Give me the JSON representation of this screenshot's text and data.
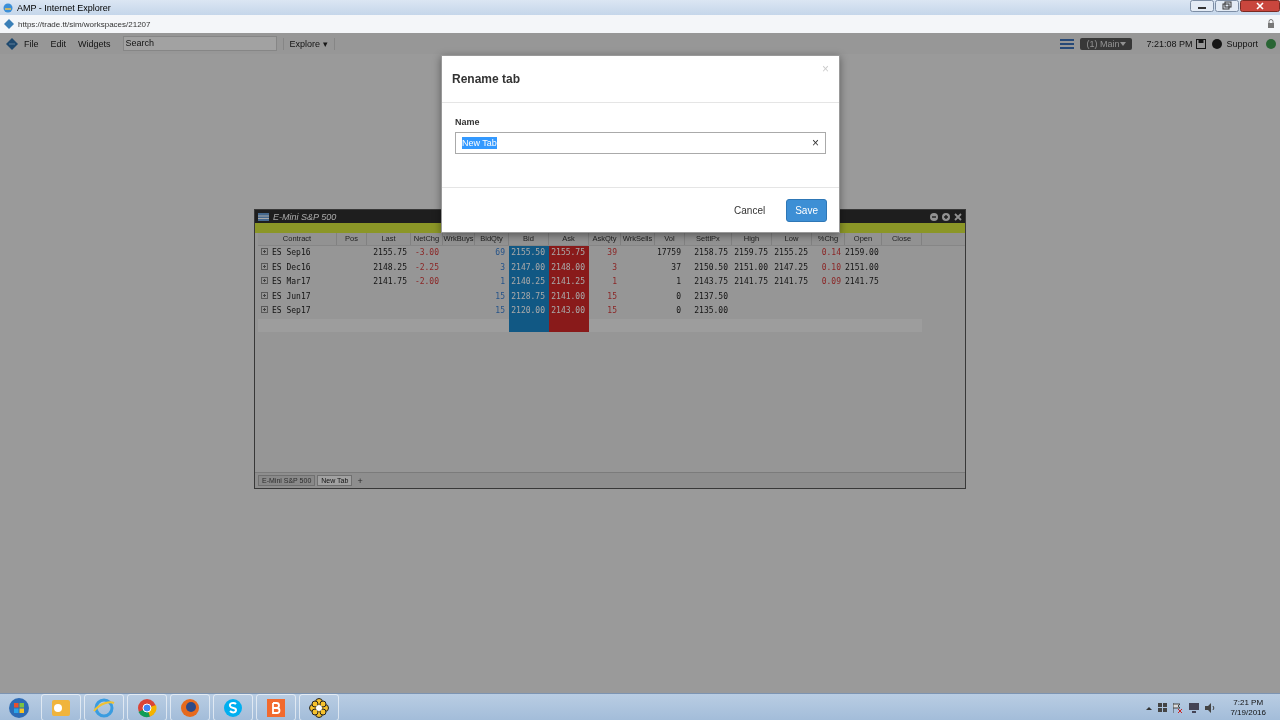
{
  "browser": {
    "title": "AMP - Internet Explorer",
    "address": "https://trade.tt/sim/workspaces/21207"
  },
  "toolbar": {
    "menus": [
      "File",
      "Edit",
      "Widgets"
    ],
    "search": {
      "placeholder": "Search"
    },
    "explore": "Explore ▾",
    "workspace": "(1) Main",
    "time": "7:21:08 PM",
    "support": "Support"
  },
  "widget": {
    "title": "E-Mini S&P 500",
    "columns": [
      "Contract",
      "Pos",
      "Last",
      "NetChg",
      "WrkBuys",
      "BidQty",
      "Bid",
      "Ask",
      "AskQty",
      "WrkSells",
      "Vol",
      "SettlPx",
      "High",
      "Low",
      "%Chg",
      "Open",
      "Close"
    ],
    "rows": [
      [
        "ES Sep16",
        "",
        "2155.75",
        "-3.00",
        "",
        "69",
        "2155.50",
        "2155.75",
        "39",
        "",
        "17759",
        "2158.75",
        "2159.75",
        "2155.25",
        "0.14",
        "2159.00",
        ""
      ],
      [
        "ES Dec16",
        "",
        "2148.25",
        "-2.25",
        "",
        "3",
        "2147.00",
        "2148.00",
        "3",
        "",
        "37",
        "2150.50",
        "2151.00",
        "2147.25",
        "0.10",
        "2151.00",
        ""
      ],
      [
        "ES Mar17",
        "",
        "2141.75",
        "-2.00",
        "",
        "1",
        "2140.25",
        "2141.25",
        "1",
        "",
        "1",
        "2143.75",
        "2141.75",
        "2141.75",
        "0.09",
        "2141.75",
        ""
      ],
      [
        "ES Jun17",
        "",
        "",
        "",
        "",
        "15",
        "2128.75",
        "2141.00",
        "15",
        "",
        "0",
        "2137.50",
        "",
        "",
        "",
        "",
        ""
      ],
      [
        "ES Sep17",
        "",
        "",
        "",
        "",
        "15",
        "2120.00",
        "2143.00",
        "15",
        "",
        "0",
        "2135.00",
        "",
        "",
        "",
        "",
        ""
      ]
    ],
    "tabs": [
      {
        "label": "E-Mini S&P 500",
        "selected": false
      },
      {
        "label": "New Tab",
        "selected": true
      }
    ],
    "add_tab": "+"
  },
  "dialog": {
    "title": "Rename tab",
    "close": "×",
    "field_label": "Name",
    "value": "New Tab",
    "clear": "×",
    "buttons": [
      {
        "label": "Cancel",
        "kind": "secondary"
      },
      {
        "label": "Save",
        "kind": "primary"
      }
    ]
  },
  "taskbar": {
    "time": "7:21 PM",
    "date": "7/19/2016"
  }
}
